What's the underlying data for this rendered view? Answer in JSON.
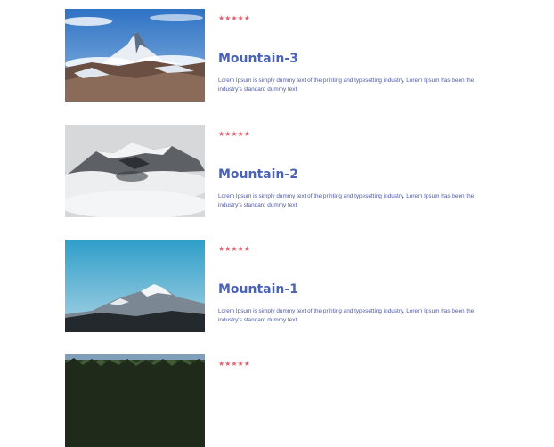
{
  "colors": {
    "star": "#e35d6a",
    "title": "#4a63b7",
    "description": "#4e5aa5"
  },
  "cards": [
    {
      "rating": 5,
      "stars": "★★★★★",
      "title": "Mountain-3",
      "description": "Lorem Ipsum is simply dummy text of the printing and typesetting industry. Lorem Ipsum has been the industry's standard dummy text"
    },
    {
      "rating": 5,
      "stars": "★★★★★",
      "title": "Mountain-2",
      "description": "Lorem Ipsum is simply dummy text of the printing and typesetting industry. Lorem Ipsum has been the industry's standard dummy text"
    },
    {
      "rating": 5,
      "stars": "★★★★★",
      "title": "Mountain-1",
      "description": "Lorem Ipsum is simply dummy text of the printing and typesetting industry. Lorem Ipsum has been the industry's standard dummy text"
    },
    {
      "rating": 5,
      "stars": "★★★★★"
    }
  ]
}
